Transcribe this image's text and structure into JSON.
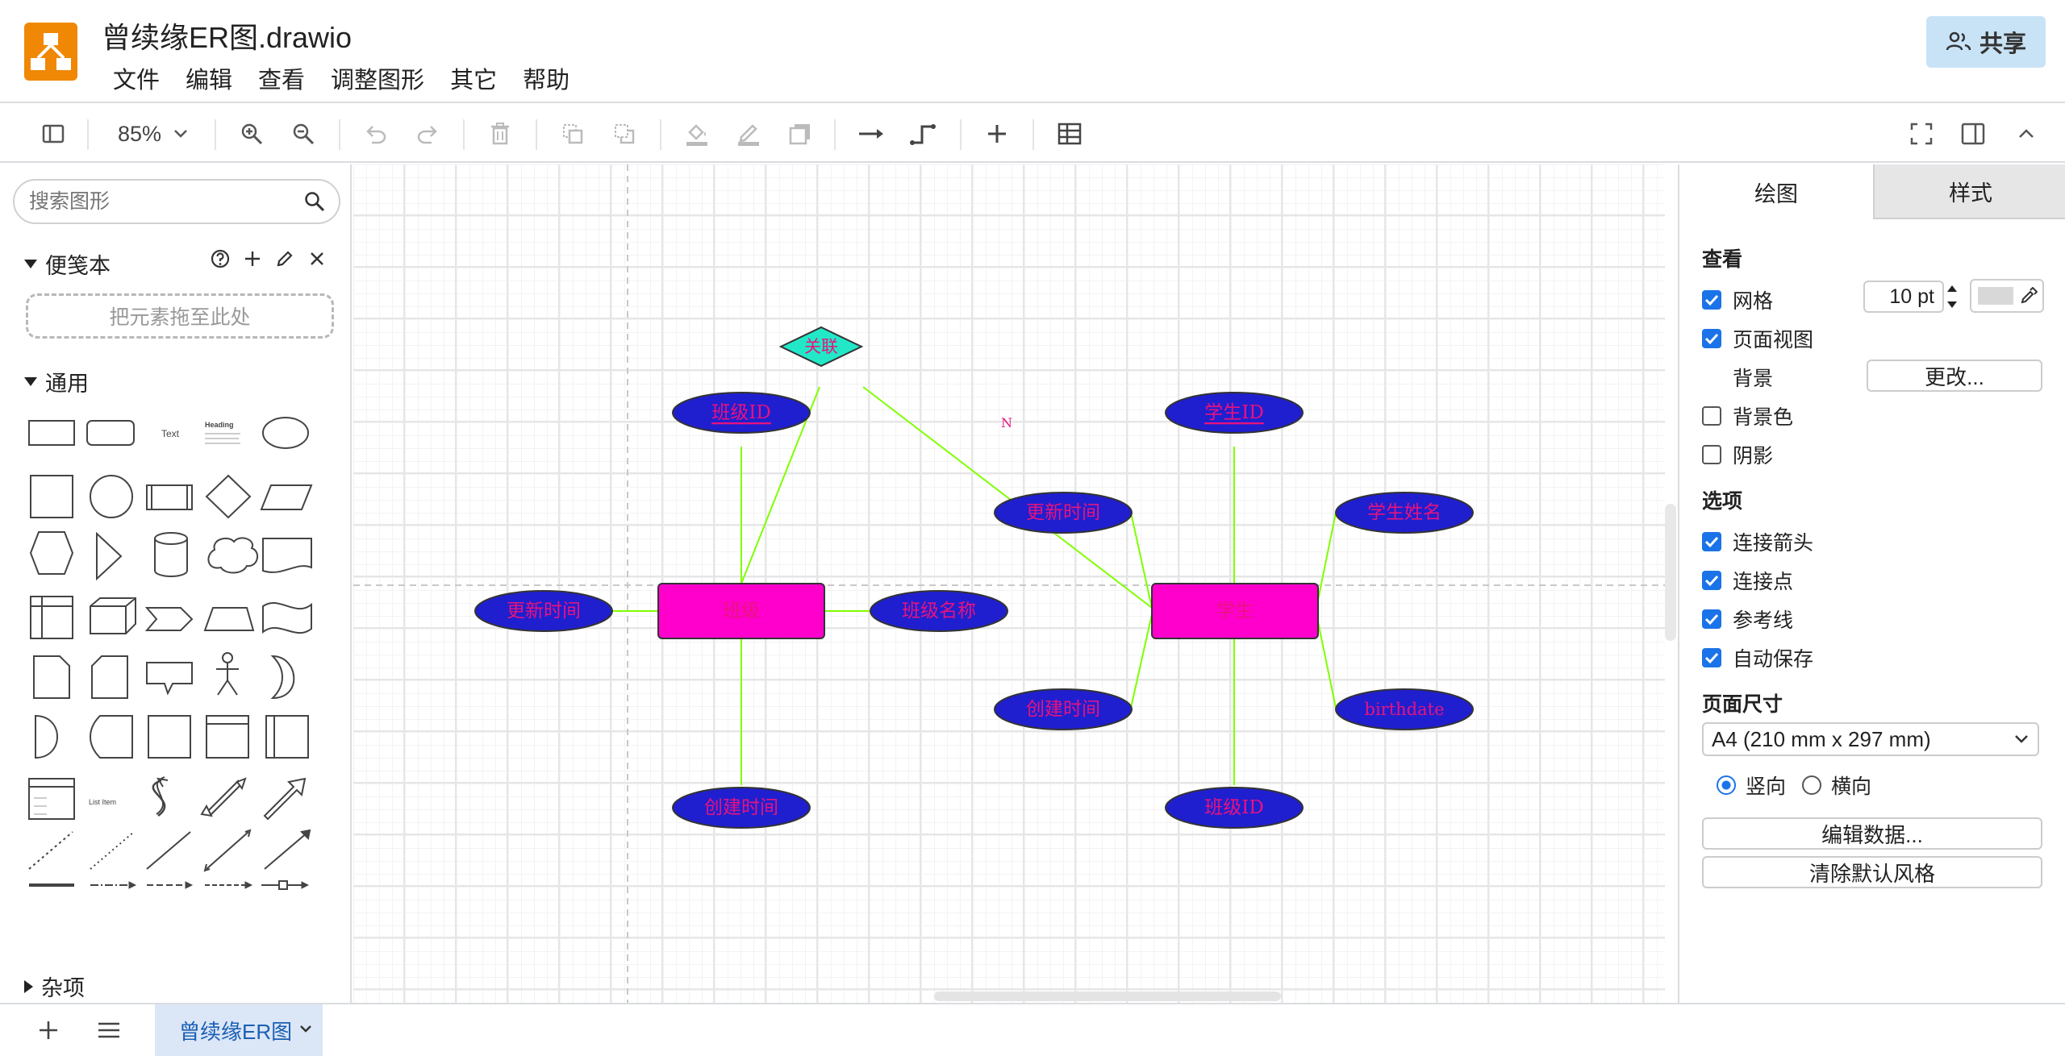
{
  "app": {
    "title": "曾续缘ER图.drawio",
    "share_label": "共享",
    "menu": [
      "文件",
      "编辑",
      "查看",
      "调整图形",
      "其它",
      "帮助"
    ]
  },
  "toolbar": {
    "zoom": "85%"
  },
  "sidebar": {
    "search_placeholder": "搜索图形",
    "scratchpad_label": "便笺本",
    "dropzone_label": "把元素拖至此处",
    "general_label": "通用",
    "misc_label": "杂项",
    "shape_text_label": "Text",
    "shape_heading_label": "Heading",
    "shape_list_item_label": "List Item"
  },
  "diagram": {
    "relation": "关联",
    "entity_class": "班级",
    "entity_student": "学生",
    "class_attrs": {
      "id": "班级ID",
      "updated": "更新时间",
      "name": "班级名称",
      "created": "创建时间"
    },
    "student_attrs": {
      "id": "学生ID",
      "updated": "更新时间",
      "name": "学生姓名",
      "created": "创建时间",
      "birthdate": "birthdate",
      "class_id": "班级ID"
    },
    "edge_label": "N",
    "colors": {
      "entity_fill": "#ff00cc",
      "attr_fill": "#1f1fcf",
      "relation_fill": "#22e8c8",
      "edge": "#80ff00",
      "text": "#e8137e"
    }
  },
  "panel": {
    "tab_diagram": "绘图",
    "tab_style": "样式",
    "view_title": "查看",
    "grid_label": "网格",
    "grid_size": "10 pt",
    "page_view_label": "页面视图",
    "background_label": "背景",
    "change_button": "更改...",
    "bg_color_label": "背景色",
    "shadow_label": "阴影",
    "options_title": "选项",
    "connection_arrows_label": "连接箭头",
    "connection_points_label": "连接点",
    "guides_label": "参考线",
    "autosave_label": "自动保存",
    "page_size_title": "页面尺寸",
    "page_size_value": "A4 (210 mm x 297 mm)",
    "portrait_label": "竖向",
    "landscape_label": "横向",
    "edit_data_button": "编辑数据...",
    "clear_style_button": "清除默认风格",
    "checks": {
      "grid": true,
      "page_view": true,
      "bg_color": false,
      "shadow": false,
      "arrows": true,
      "points": true,
      "guides": true,
      "autosave": true
    }
  },
  "footer": {
    "page_tab": "曾续缘ER图"
  }
}
